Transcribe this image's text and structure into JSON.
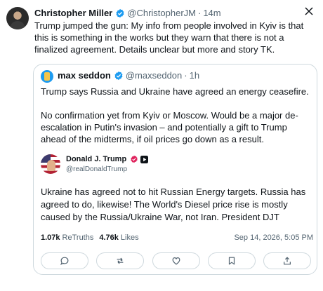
{
  "post": {
    "author_name": "Christopher Miller",
    "author_handle": "@ChristopherJM",
    "separator": "·",
    "time": "14m",
    "text": "Trump jumped the gun: My info from people involved in Kyiv is that this is something in the works but they warn that there is not a finalized agreement. Details unclear but more and story TK."
  },
  "quote": {
    "author_name": "max seddon",
    "author_handle": "@maxseddon",
    "separator": "·",
    "time": "1h",
    "paragraph_1": "Trump says Russia and Ukraine have agreed an energy ceasefire.",
    "paragraph_2": "No confirmation yet from Kyiv or Moscow. Would be a major de-escalation in Putin's invasion – and potentially a gift to Trump ahead of the midterms, if oil prices go down as a result."
  },
  "truth": {
    "author_name": "Donald J. Trump",
    "author_handle": "@realDonaldTrump",
    "text": "Ukraine has agreed not to hit Russian Energy targets. Russia has agreed to do, likewise! The World's Diesel price rise is mostly caused by the Russia/Ukraine War, not Iran. President DJT",
    "retruths_count": "1.07k",
    "retruths_label": "ReTruths",
    "likes_count": "4.76k",
    "likes_label": "Likes",
    "date": "Sep 14, 2026, 5:05 PM"
  },
  "icons": {
    "verified": "verified-badge-icon",
    "close": "close-icon",
    "reply": "reply-icon",
    "retruth": "retruth-icon",
    "like": "heart-icon",
    "bookmark": "bookmark-icon",
    "share": "share-icon"
  },
  "colors": {
    "verified_blue": "#1d9bf0",
    "secondary_text": "#536471",
    "border": "#cfd9de",
    "truth_badge_red": "#e0245e"
  }
}
